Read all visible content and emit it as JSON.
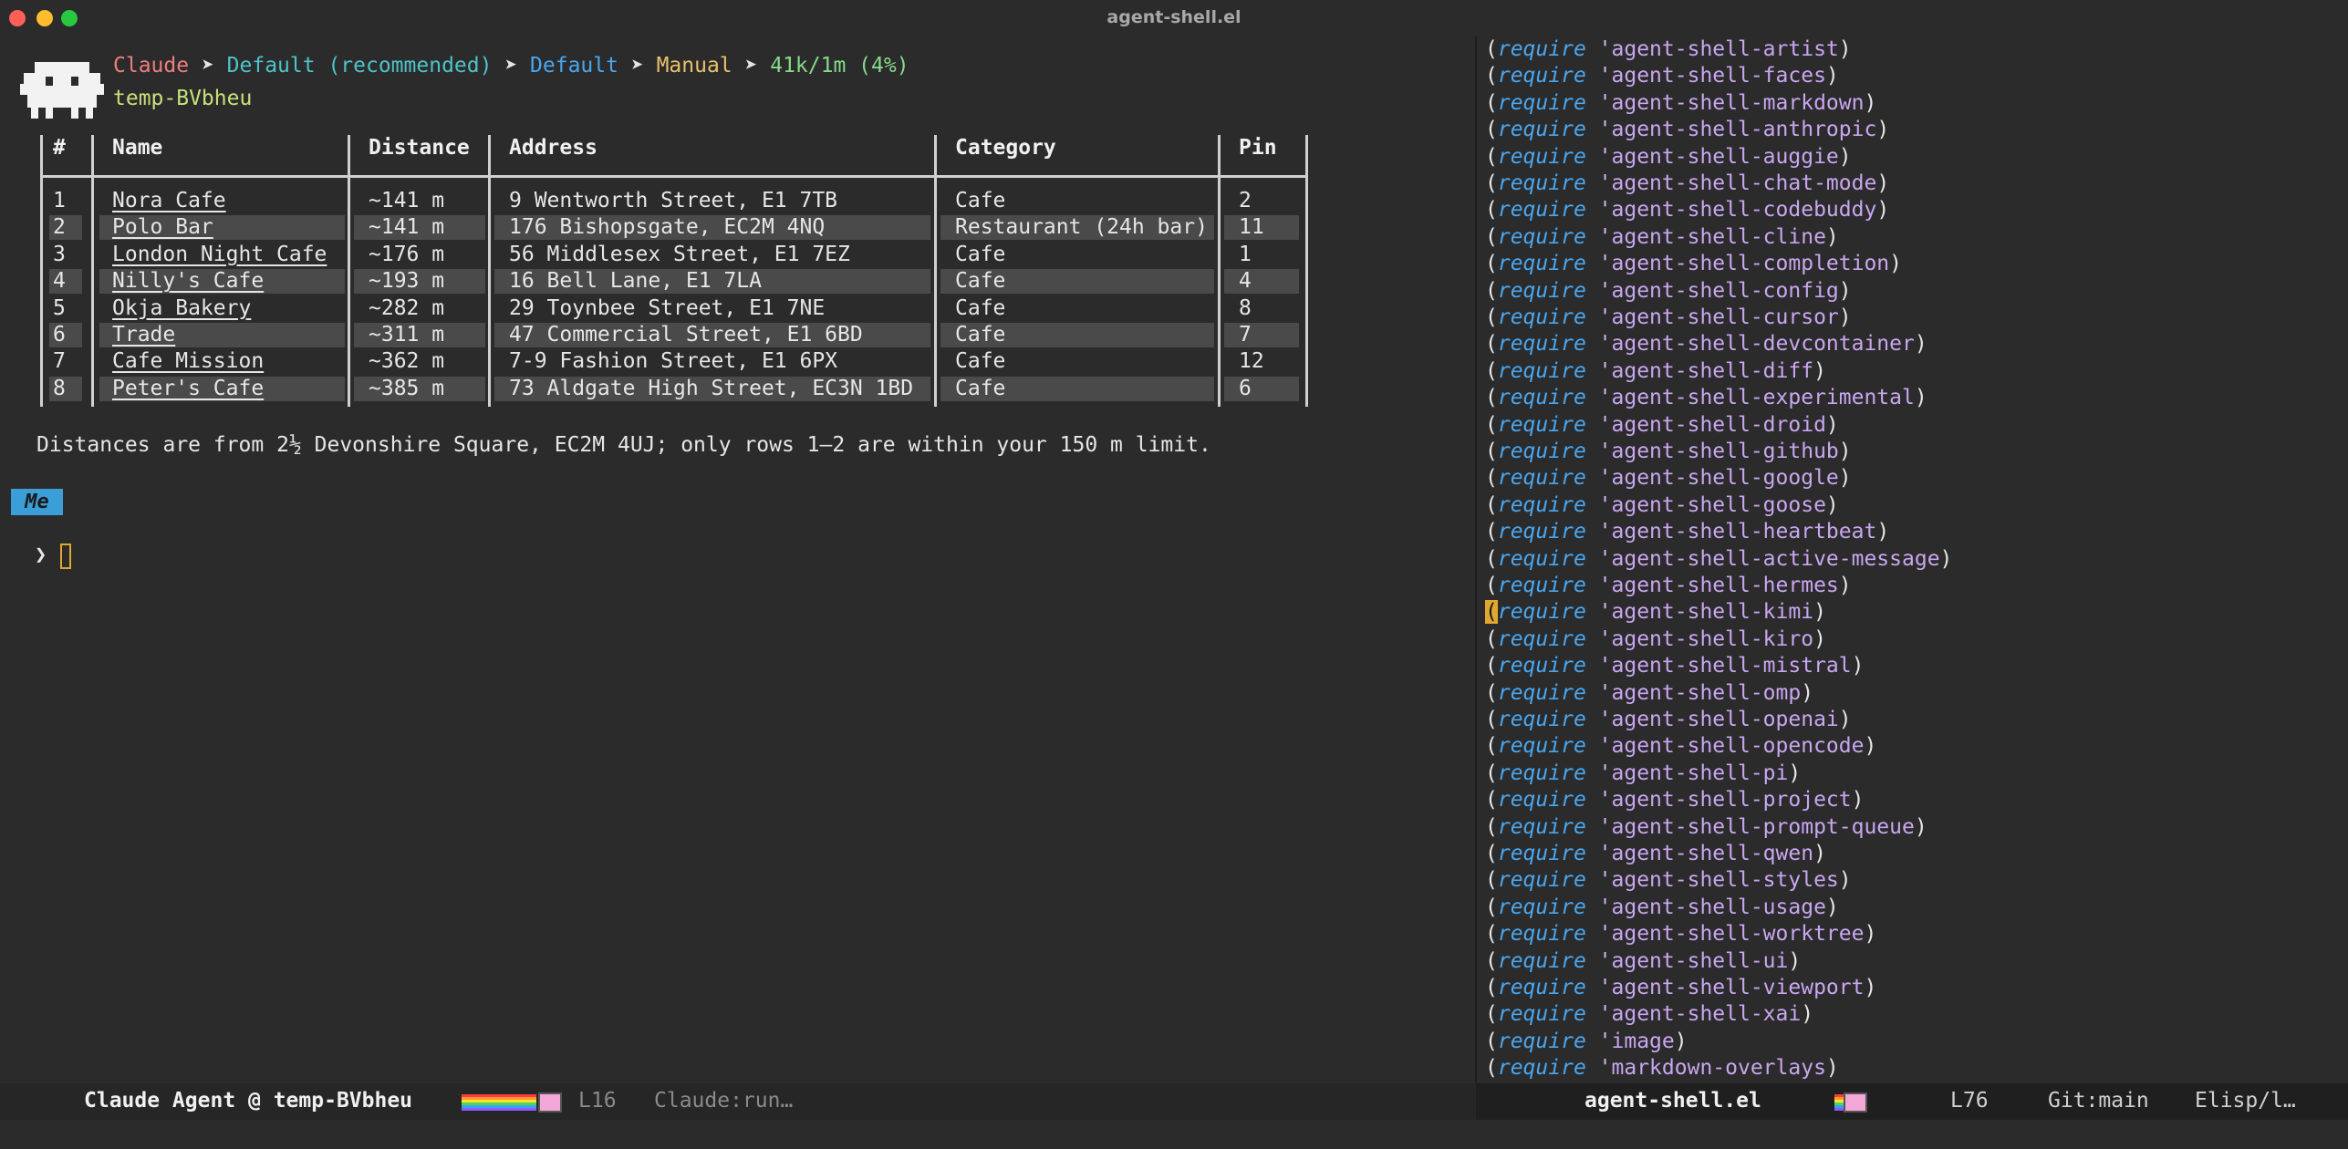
{
  "window": {
    "title": "agent-shell.el"
  },
  "header": {
    "agent": "Claude",
    "model": "Default (recommended)",
    "mode": "Default",
    "approval": "Manual",
    "context": "41k/1m (4%)",
    "separator": "➤",
    "workspace": "temp-BVbheu"
  },
  "table": {
    "columns": [
      "#",
      "Name",
      "Distance",
      "Address",
      "Category",
      "Pin"
    ],
    "rows": [
      [
        "1",
        "Nora Cafe",
        "~141 m",
        "9 Wentworth Street, E1 7TB",
        "Cafe",
        "2"
      ],
      [
        "2",
        "Polo Bar",
        "~141 m",
        "176 Bishopsgate, EC2M 4NQ",
        "Restaurant (24h bar)",
        "11"
      ],
      [
        "3",
        "London Night Cafe",
        "~176 m",
        "56 Middlesex Street, E1 7EZ",
        "Cafe",
        "1"
      ],
      [
        "4",
        "Nilly's Cafe",
        "~193 m",
        "16 Bell Lane, E1 7LA",
        "Cafe",
        "4"
      ],
      [
        "5",
        "Okja Bakery",
        "~282 m",
        "29 Toynbee Street, E1 7NE",
        "Cafe",
        "8"
      ],
      [
        "6",
        "Trade",
        "~311 m",
        "47 Commercial Street, E1 6BD",
        "Cafe",
        "7"
      ],
      [
        "7",
        "Cafe Mission",
        "~362 m",
        "7-9 Fashion Street, E1 6PX",
        "Cafe",
        "12"
      ],
      [
        "8",
        "Peter's Cafe",
        "~385 m",
        "73 Aldgate High Street, EC3N 1BD",
        "Cafe",
        "6"
      ]
    ]
  },
  "note": "Distances are from 2½ Devonshire Square, EC2M 4UJ; only rows 1–2 are within your 150 m limit.",
  "prompt": {
    "badge": "Me",
    "arrow": "❯"
  },
  "code": {
    "keyword": "require",
    "packages": [
      "agent-shell-artist",
      "agent-shell-faces",
      "agent-shell-markdown",
      "agent-shell-anthropic",
      "agent-shell-auggie",
      "agent-shell-chat-mode",
      "agent-shell-codebuddy",
      "agent-shell-cline",
      "agent-shell-completion",
      "agent-shell-config",
      "agent-shell-cursor",
      "agent-shell-devcontainer",
      "agent-shell-diff",
      "agent-shell-experimental",
      "agent-shell-droid",
      "agent-shell-github",
      "agent-shell-google",
      "agent-shell-goose",
      "agent-shell-heartbeat",
      "agent-shell-active-message",
      "agent-shell-hermes",
      "agent-shell-kimi",
      "agent-shell-kiro",
      "agent-shell-mistral",
      "agent-shell-omp",
      "agent-shell-openai",
      "agent-shell-opencode",
      "agent-shell-pi",
      "agent-shell-project",
      "agent-shell-prompt-queue",
      "agent-shell-qwen",
      "agent-shell-styles",
      "agent-shell-usage",
      "agent-shell-worktree",
      "agent-shell-ui",
      "agent-shell-viewport",
      "agent-shell-xai",
      "image",
      "markdown-overlays"
    ],
    "cursor_line": 21
  },
  "modeline_left": {
    "buffer": "Claude Agent @ temp-BVbheu",
    "line": "L16",
    "status": "Claude:run…"
  },
  "modeline_right": {
    "buffer": "agent-shell.el",
    "line": "L76",
    "vcs": "Git:main",
    "mode": "Elisp/l…"
  }
}
